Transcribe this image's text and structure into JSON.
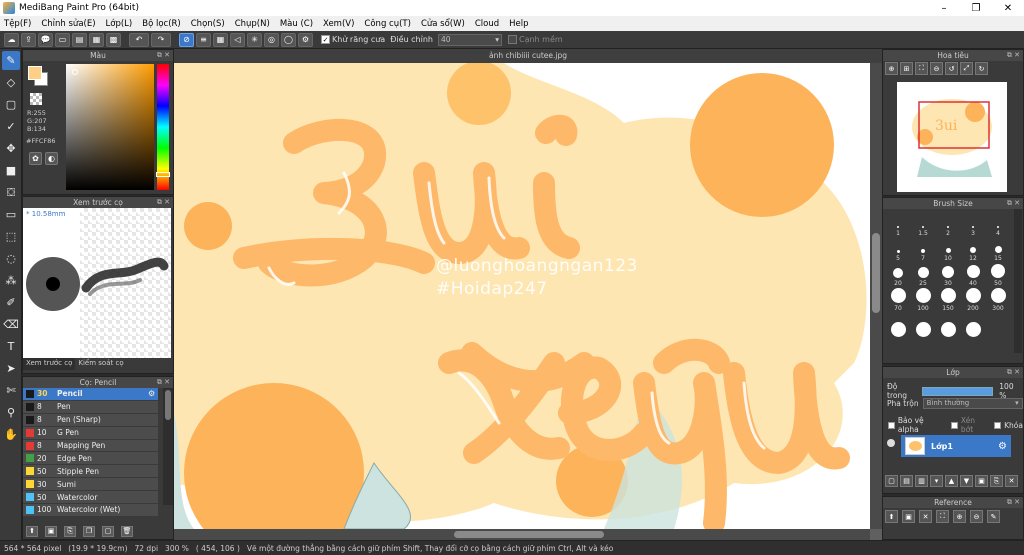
{
  "window": {
    "title": "MediBang Paint Pro (64bit)"
  },
  "menu": [
    "Tệp(F)",
    "Chỉnh sửa(E)",
    "Lớp(L)",
    "Bộ lọc(R)",
    "Chọn(S)",
    "Chụp(N)",
    "Màu (C)",
    "Xem(V)",
    "Công cụ(T)",
    "Cửa sổ(W)",
    "Cloud",
    "Help"
  ],
  "toolbar": {
    "antialias_label": "Khử răng cưa",
    "adjust_label": "Điều chỉnh",
    "adjust_value": "40",
    "edge_label": "Cạnh mềm"
  },
  "color_panel": {
    "title": "Màu",
    "fg_color": "#FFCF86",
    "r": "R:255",
    "g": "G:207",
    "b": "B:134",
    "hex": "#FFCF86"
  },
  "brush_preview": {
    "title": "Xem trước cọ",
    "size": "10.58mm",
    "tab_preview": "Xem trước cọ",
    "tab_control": "Kiểm soát cọ"
  },
  "brush_panel": {
    "title": "Cọ: Pencil",
    "brushes": [
      {
        "size": "30",
        "name": "Pencil",
        "color": "#1a1a1a",
        "selected": true
      },
      {
        "size": "8",
        "name": "Pen",
        "color": "#1a1a1a",
        "selected": false
      },
      {
        "size": "8",
        "name": "Pen (Sharp)",
        "color": "#1a1a1a",
        "selected": false
      },
      {
        "size": "10",
        "name": "G Pen",
        "color": "#e53935",
        "selected": false
      },
      {
        "size": "8",
        "name": "Mapping Pen",
        "color": "#e53935",
        "selected": false
      },
      {
        "size": "20",
        "name": "Edge Pen",
        "color": "#43a047",
        "selected": false
      },
      {
        "size": "50",
        "name": "Stipple Pen",
        "color": "#fdd835",
        "selected": false
      },
      {
        "size": "30",
        "name": "Sumi",
        "color": "#fdd835",
        "selected": false
      },
      {
        "size": "50",
        "name": "Watercolor",
        "color": "#4fc3f7",
        "selected": false
      },
      {
        "size": "100",
        "name": "Watercolor (Wet)",
        "color": "#4fc3f7",
        "selected": false
      }
    ]
  },
  "document": {
    "tab_title": "ảnh chibiiii cutee.jpg",
    "watermark_line1": "@luonghoangngan123",
    "watermark_line2": "#Hoidap247"
  },
  "navigator": {
    "title": "Hoa tiêu"
  },
  "brush_size": {
    "title": "Brush Size",
    "sizes": [
      "1",
      "1.5",
      "2",
      "3",
      "4",
      "5",
      "7",
      "10",
      "12",
      "15",
      "20",
      "25",
      "30",
      "40",
      "50",
      "70",
      "100",
      "150",
      "200",
      "300",
      "",
      "",
      "",
      ""
    ]
  },
  "layer_panel": {
    "title": "Lớp",
    "opacity_label": "Độ trong",
    "opacity_value": "100 %",
    "opacity_fraction": 1.0,
    "blend_label": "Pha trộn",
    "blend_value": "Bình thường",
    "protect_alpha": "Bảo vệ alpha",
    "clipping": "Xén bớt",
    "lock": "Khóa",
    "layer_name": "Lớp1"
  },
  "reference": {
    "title": "Reference"
  },
  "status": {
    "size": "564 * 564 pixel",
    "cm": "(19.9 * 19.9cm)",
    "dpi": "72 dpi",
    "zoom": "300 %",
    "coords": "( 454, 106 )",
    "hint": "Vẽ một đường thẳng bằng cách giữ phím Shift, Thay đổi cỡ cọ bằng cách giữ phím Ctrl, Alt và kéo"
  }
}
